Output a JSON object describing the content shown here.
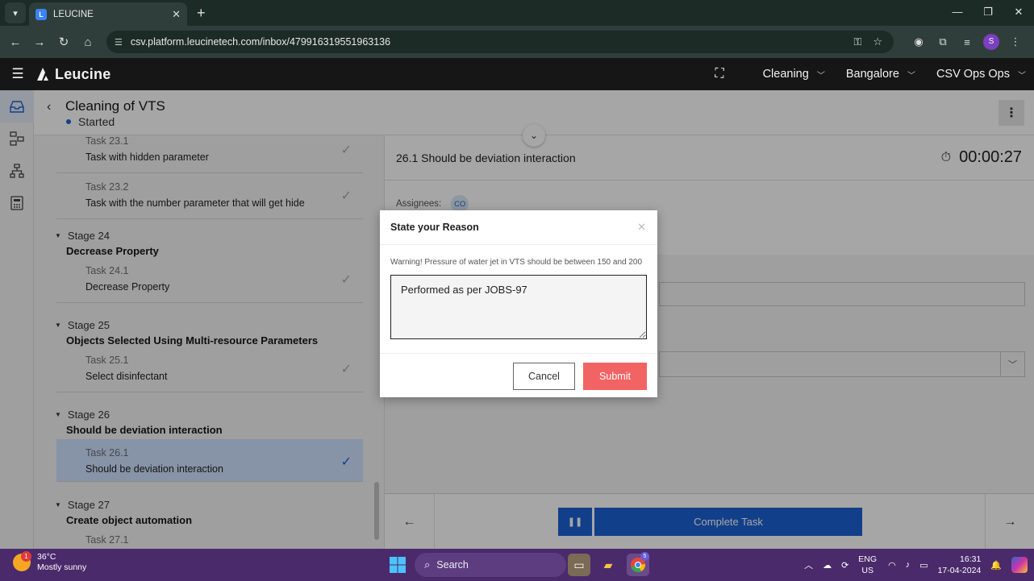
{
  "browser": {
    "tab_title": "LEUCINE",
    "tab_close": "✕",
    "new_tab": "+",
    "url": "csv.platform.leucinetech.com/inbox/479916319551963136",
    "window_controls": [
      "—",
      "❐",
      "✕"
    ],
    "profile_initial": "S"
  },
  "app": {
    "brand": "Leucine",
    "header_dropdowns": [
      "Cleaning",
      "Bangalore",
      "CSV Ops Ops"
    ]
  },
  "job": {
    "title": "Cleaning of VTS",
    "state": "Started"
  },
  "stages": [
    {
      "stage_no": "",
      "stage_name": "",
      "tasks": [
        {
          "task_no": "Task 23.1",
          "task_name": "Task with hidden parameter"
        },
        {
          "task_no": "Task 23.2",
          "task_name": "Task with the number parameter that will get hide"
        }
      ]
    },
    {
      "stage_no": "Stage 24",
      "stage_name": "Decrease Property",
      "tasks": [
        {
          "task_no": "Task 24.1",
          "task_name": "Decrease Property"
        }
      ]
    },
    {
      "stage_no": "Stage 25",
      "stage_name": "Objects Selected Using Multi-resource Parameters",
      "tasks": [
        {
          "task_no": "Task 25.1",
          "task_name": "Select disinfectant"
        }
      ]
    },
    {
      "stage_no": "Stage 26",
      "stage_name": "Should be deviation interaction",
      "tasks": [
        {
          "task_no": "Task 26.1",
          "task_name": "Should be deviation interaction"
        }
      ]
    },
    {
      "stage_no": "Stage 27",
      "stage_name": "Create object automation",
      "tasks": [
        {
          "task_no": "Task 27.1",
          "task_name": ""
        }
      ]
    }
  ],
  "task_panel": {
    "title": "26.1 Should be deviation interaction",
    "timer": "00:00:27",
    "assignees_label": "Assignees:",
    "assignee_initials": "CO",
    "complete_label": "Complete Task"
  },
  "modal": {
    "title": "State your Reason",
    "warning": "Warning! Pressure of water jet in VTS should be between 150 and 200",
    "reason_value": "Performed as per JOBS-97",
    "cancel_label": "Cancel",
    "submit_label": "Submit"
  },
  "taskbar": {
    "temperature": "36°C",
    "weather": "Mostly sunny",
    "weather_badge": "1",
    "search_label": "Search",
    "lang_top": "ENG",
    "lang_bottom": "US",
    "time": "16:31",
    "date": "17-04-2024",
    "chrome_badge": "5"
  }
}
